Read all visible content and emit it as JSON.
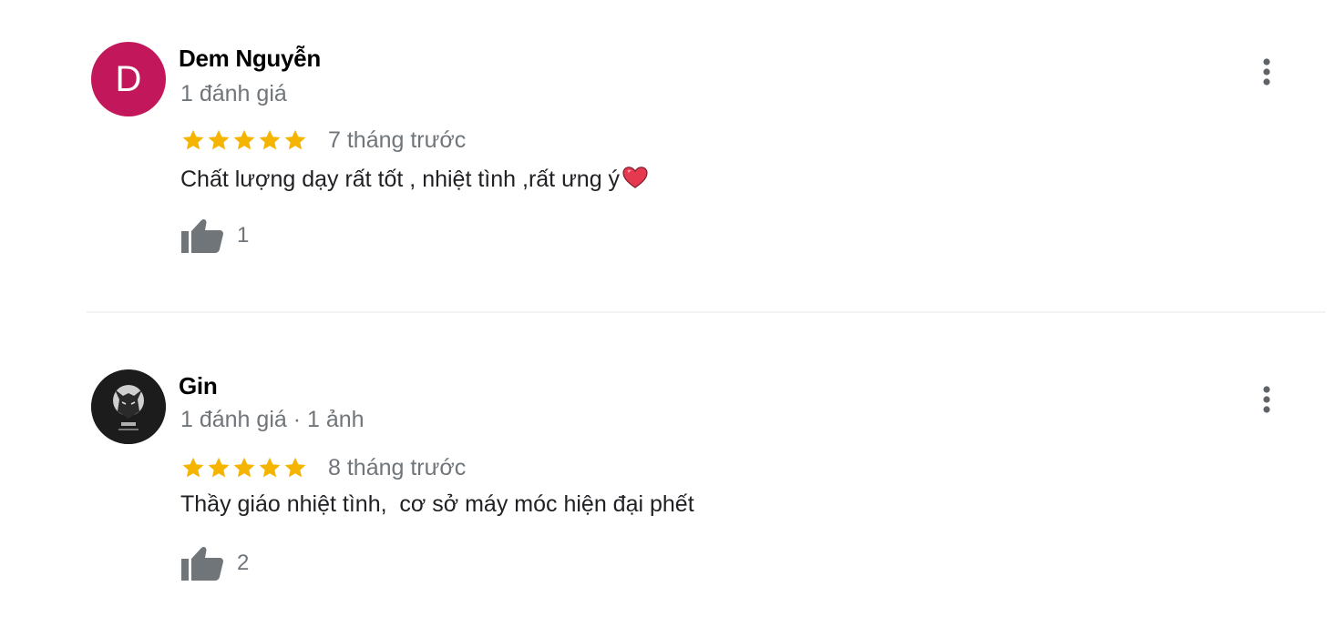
{
  "reviews": [
    {
      "reviewer_name": "Dem Nguyễn",
      "avatar_letter": "D",
      "avatar_color": "#c2185b",
      "meta": "1 đánh giá",
      "rating": 5,
      "time_ago": "7 tháng trước",
      "text": "Chất lượng dạy rất tốt , nhiệt tình ,rất ưng ý",
      "text_emoji": "heart-icon",
      "likes": "1"
    },
    {
      "reviewer_name": "Gin",
      "avatar_letter": "",
      "avatar_color": "#1e1e1e",
      "meta": "1 đánh giá · 1 ảnh",
      "rating": 5,
      "time_ago": "8 tháng trước",
      "text": "Thầy giáo nhiệt tình,  cơ sở máy móc hiện đại phết",
      "text_emoji": "",
      "likes": "2"
    }
  ],
  "colors": {
    "star": "#f4b400",
    "icon_gray": "#70757a",
    "heart": "#e53950"
  }
}
